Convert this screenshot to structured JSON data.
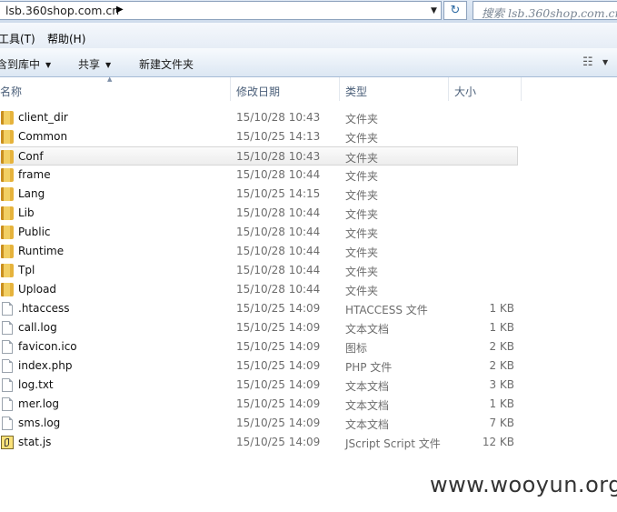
{
  "address_bar": {
    "path": "lsb.360shop.com.cn",
    "search_placeholder": "搜索 lsb.360shop.com.cn"
  },
  "menu": {
    "items": [
      {
        "label": "工具(T)"
      },
      {
        "label": "帮助(H)"
      }
    ]
  },
  "toolbar": {
    "include_library_label": "含到库中",
    "share_label": "共享",
    "new_folder_label": "新建文件夹"
  },
  "columns": {
    "name": "名称",
    "date": "修改日期",
    "type": "类型",
    "size": "大小"
  },
  "files": [
    {
      "name": "client_dir",
      "date": "15/10/28 10:43",
      "type": "文件夹",
      "size": "",
      "icon": "folder-icon"
    },
    {
      "name": "Common",
      "date": "15/10/25 14:13",
      "type": "文件夹",
      "size": "",
      "icon": "folder-icon"
    },
    {
      "name": "Conf",
      "date": "15/10/28 10:43",
      "type": "文件夹",
      "size": "",
      "icon": "folder-icon",
      "selected": true
    },
    {
      "name": "frame",
      "date": "15/10/28 10:44",
      "type": "文件夹",
      "size": "",
      "icon": "folder-icon"
    },
    {
      "name": "Lang",
      "date": "15/10/25 14:15",
      "type": "文件夹",
      "size": "",
      "icon": "folder-icon"
    },
    {
      "name": "Lib",
      "date": "15/10/28 10:44",
      "type": "文件夹",
      "size": "",
      "icon": "folder-icon"
    },
    {
      "name": "Public",
      "date": "15/10/28 10:44",
      "type": "文件夹",
      "size": "",
      "icon": "folder-icon"
    },
    {
      "name": "Runtime",
      "date": "15/10/28 10:44",
      "type": "文件夹",
      "size": "",
      "icon": "folder-icon"
    },
    {
      "name": "Tpl",
      "date": "15/10/28 10:44",
      "type": "文件夹",
      "size": "",
      "icon": "folder-icon"
    },
    {
      "name": "Upload",
      "date": "15/10/28 10:44",
      "type": "文件夹",
      "size": "",
      "icon": "folder-icon"
    },
    {
      "name": ".htaccess",
      "date": "15/10/25 14:09",
      "type": "HTACCESS 文件",
      "size": "1 KB",
      "icon": "file-icon"
    },
    {
      "name": "call.log",
      "date": "15/10/25 14:09",
      "type": "文本文档",
      "size": "1 KB",
      "icon": "file-icon"
    },
    {
      "name": "favicon.ico",
      "date": "15/10/25 14:09",
      "type": "图标",
      "size": "2 KB",
      "icon": "file-icon"
    },
    {
      "name": "index.php",
      "date": "15/10/25 14:09",
      "type": "PHP 文件",
      "size": "2 KB",
      "icon": "file-icon"
    },
    {
      "name": "log.txt",
      "date": "15/10/25 14:09",
      "type": "文本文档",
      "size": "3 KB",
      "icon": "file-icon"
    },
    {
      "name": "mer.log",
      "date": "15/10/25 14:09",
      "type": "文本文档",
      "size": "1 KB",
      "icon": "file-icon"
    },
    {
      "name": "sms.log",
      "date": "15/10/25 14:09",
      "type": "文本文档",
      "size": "7 KB",
      "icon": "file-icon"
    },
    {
      "name": "stat.js",
      "date": "15/10/25 14:09",
      "type": "JScript Script 文件",
      "size": "12 KB",
      "icon": "script-icon"
    }
  ],
  "watermark": "www.wooyun.org"
}
